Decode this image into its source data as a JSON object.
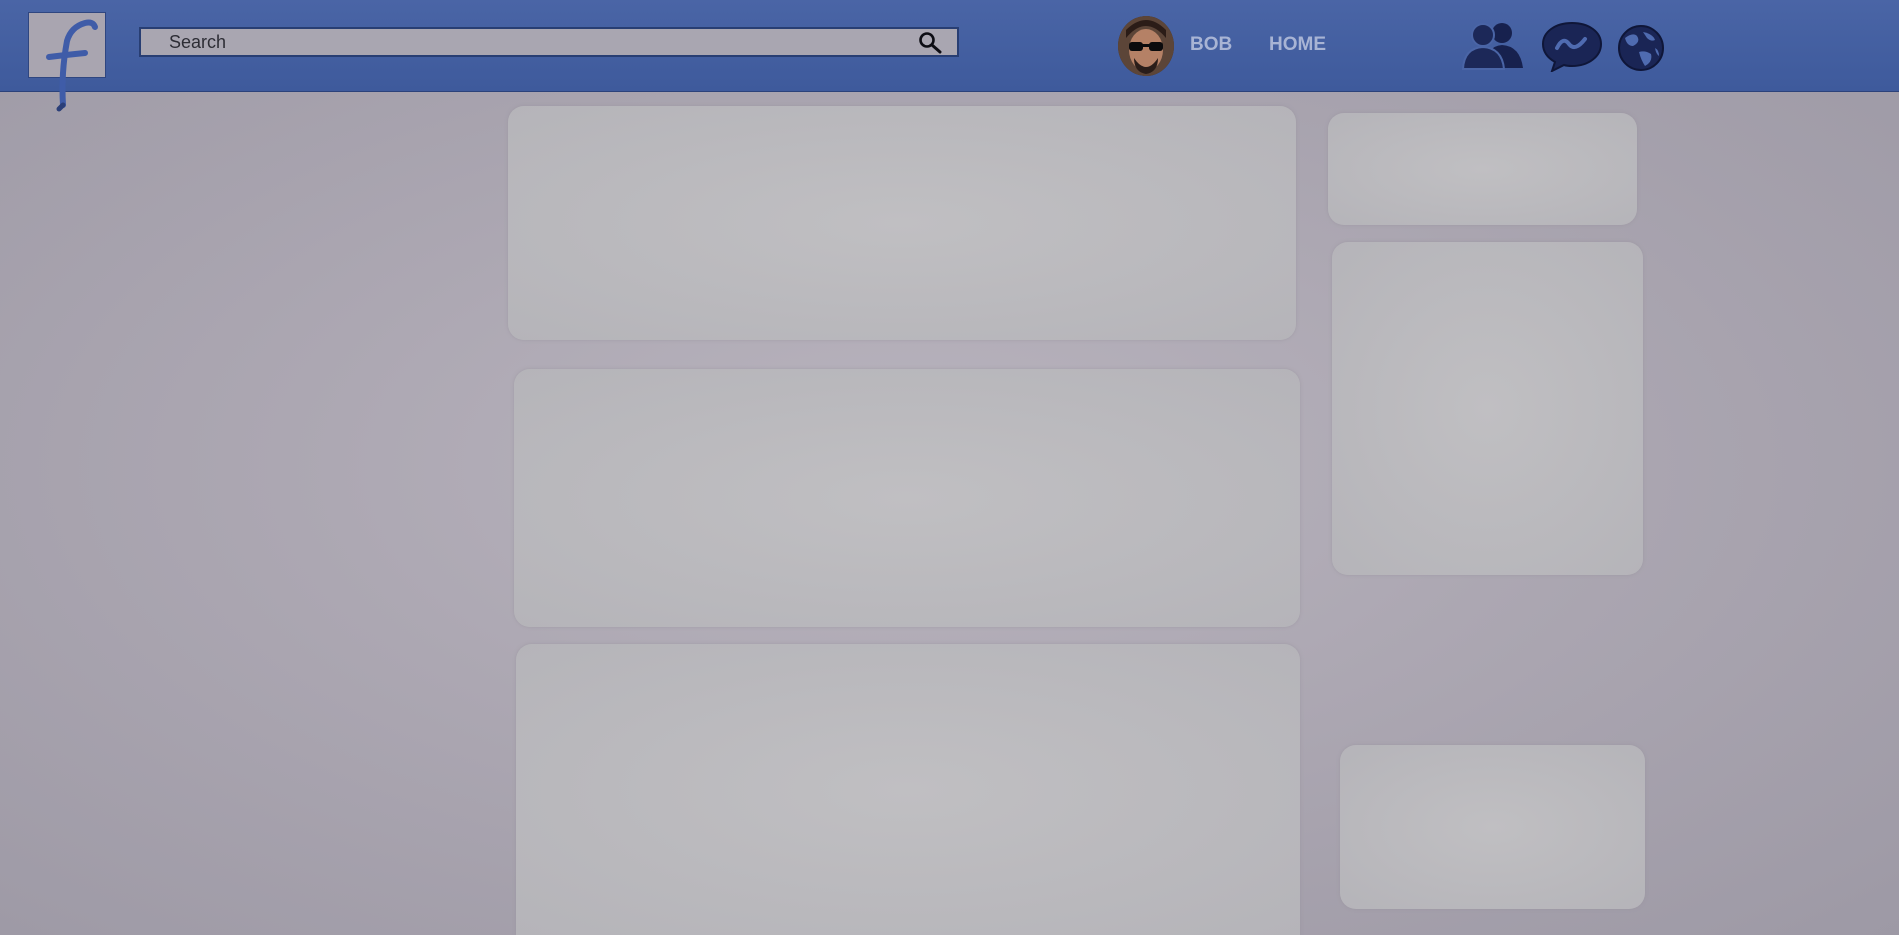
{
  "app": {
    "logo_letter": "f"
  },
  "header": {
    "search": {
      "placeholder": "Search",
      "value": ""
    },
    "profile_name": "BOB",
    "home_label": "HOME",
    "icons": [
      "friends-icon",
      "messages-icon",
      "globe-icon",
      "search-icon"
    ]
  },
  "colors": {
    "header_bg": "#3e5a9c",
    "page_bg": "#aca7b2",
    "panel_bg": "#b9b8bd",
    "nav_text": "#a8b4d4",
    "icon_fill": "#1a2555"
  },
  "main": {
    "feed_posts": [
      "",
      "",
      ""
    ]
  },
  "sidebar": {
    "panels": [
      "",
      "",
      ""
    ]
  }
}
